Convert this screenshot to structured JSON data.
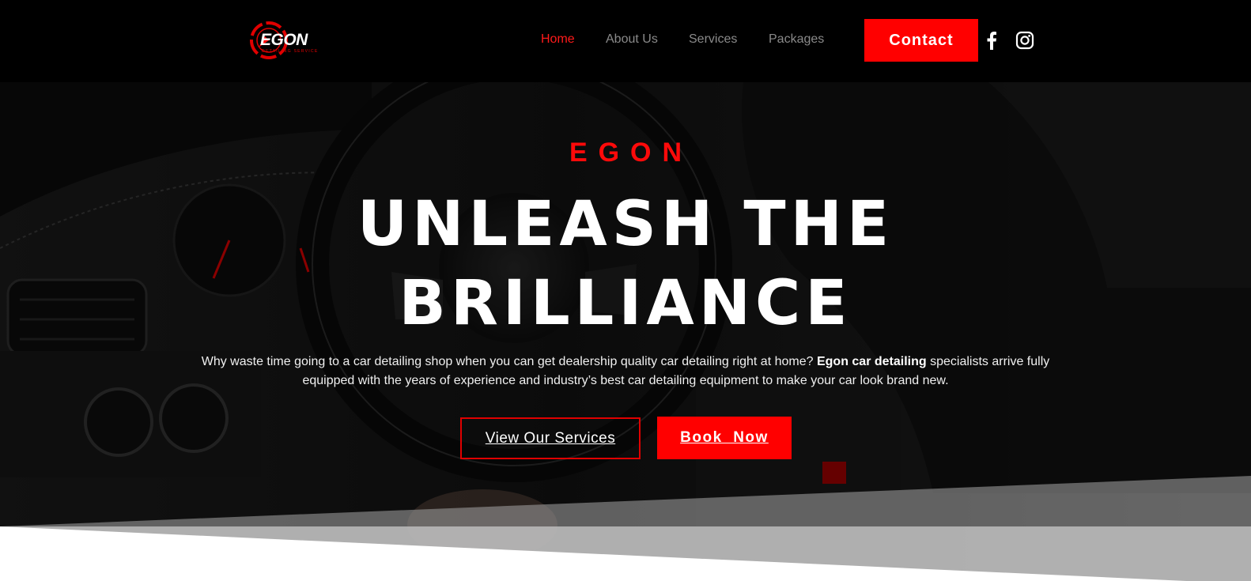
{
  "brand": {
    "logo_text": "EGON",
    "logo_subtext": "DETAILING SERVICE",
    "accent": "#ff0000"
  },
  "nav": {
    "items": [
      {
        "label": "Home",
        "active": true
      },
      {
        "label": "About Us",
        "active": false
      },
      {
        "label": "Services",
        "active": false
      },
      {
        "label": "Packages",
        "active": false
      }
    ],
    "contact_label": "Contact",
    "social": [
      {
        "icon": "facebook-icon"
      },
      {
        "icon": "instagram-icon"
      }
    ]
  },
  "hero": {
    "eyebrow": "EGON",
    "title_line1": "UNLEASH THE",
    "title_line2": "BRILLIANCE",
    "desc_part1": "Why waste time going to a car detailing shop when you can get dealership quality car detailing right at home? ",
    "desc_bold": "Egon car detailing",
    "desc_part2": " specialists arrive fully equipped with the years of experience and industry’s best car detailing equipment to make your car look brand new.",
    "btn_secondary": "View Our Services",
    "btn_primary": "Book  Now"
  }
}
